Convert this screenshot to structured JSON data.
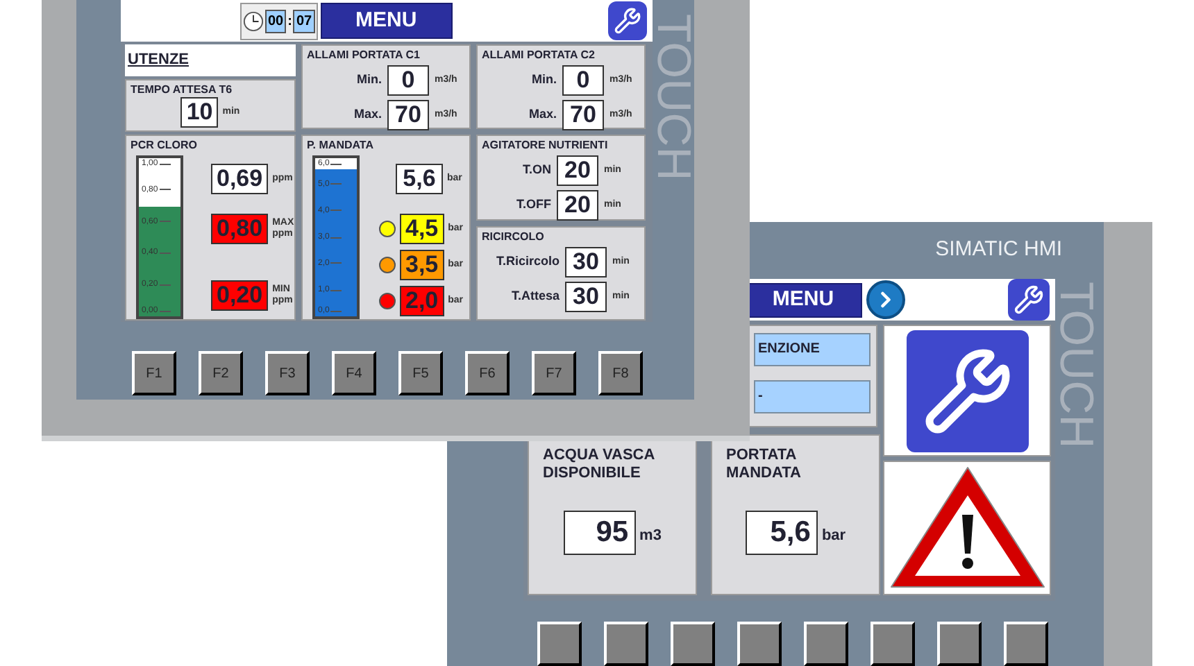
{
  "front_panel": {
    "header": {
      "timer_hours": "00",
      "timer_separator": ":",
      "timer_minutes": "07",
      "menu": "MENU"
    },
    "utenze": {
      "title": "UTENZE"
    },
    "tempo_attesa": {
      "title": "TEMPO ATTESA T6",
      "value": "10",
      "unit": "min"
    },
    "alarm_flows": [
      {
        "title": "ALLAMI PORTATA C1",
        "rows": [
          {
            "label": "Min.",
            "value": "0",
            "unit": "m3/h"
          },
          {
            "label": "Max.",
            "value": "70",
            "unit": "m3/h"
          }
        ]
      },
      {
        "title": "ALLAMI PORTATA C2",
        "rows": [
          {
            "label": "Min.",
            "value": "0",
            "unit": "m3/h"
          },
          {
            "label": "Max.",
            "value": "70",
            "unit": "m3/h"
          }
        ]
      }
    ],
    "pcr_cloro": {
      "title": "PCR CLORO",
      "gauge": {
        "level": 0.69,
        "scale": [
          "1,00",
          "0,80",
          "0,60",
          "0,40",
          "0,20",
          "0,00"
        ]
      },
      "readings": [
        {
          "kind": "normal",
          "value": "0,69",
          "unit": "ppm"
        },
        {
          "kind": "alarm",
          "value": "0,80",
          "limit": "MAX",
          "unit": "ppm"
        },
        {
          "kind": "alarm",
          "value": "0,20",
          "limit": "MIN",
          "unit": "ppm"
        }
      ]
    },
    "p_mandata": {
      "title": "P. MANDATA",
      "gauge": {
        "level": 0.93,
        "scale": [
          "6,0",
          "5,0",
          "4,0",
          "3,0",
          "2,0",
          "1,0",
          "0,0"
        ]
      },
      "reading": {
        "value": "5,6",
        "unit": "bar"
      },
      "thresholds": [
        {
          "color": "#ffff00",
          "value": "4,5",
          "unit": "bar"
        },
        {
          "color": "#ff9900",
          "value": "3,5",
          "unit": "bar"
        },
        {
          "color": "#ff0000",
          "value": "2,0",
          "unit": "bar"
        }
      ]
    },
    "agitatore": {
      "title": "AGITATORE NUTRIENTI",
      "rows": [
        {
          "label": "T.ON",
          "value": "20",
          "unit": "min"
        },
        {
          "label": "T.OFF",
          "value": "20",
          "unit": "min"
        }
      ]
    },
    "ricircolo": {
      "title": "RICIRCOLO",
      "rows": [
        {
          "label": "T.Ricircolo",
          "value": "30",
          "unit": "min"
        },
        {
          "label": "T.Attesa",
          "value": "30",
          "unit": "min"
        }
      ]
    },
    "side_label": "TOUCH",
    "function_keys": [
      "F1",
      "F2",
      "F3",
      "F4",
      "F5",
      "F6",
      "F7",
      "F8"
    ]
  },
  "back_panel": {
    "brand": "SIMATIC HMI",
    "side_label": "TOUCH",
    "header": {
      "menu": "MENU"
    },
    "fields": [
      "ENZIONE",
      "-"
    ],
    "cards": [
      {
        "title": "ACQUA VASCA DISPONIBILE",
        "value": "95",
        "unit": "m3"
      },
      {
        "title": "PORTATA MANDATA",
        "value": "5,6",
        "unit": "bar"
      }
    ]
  }
}
